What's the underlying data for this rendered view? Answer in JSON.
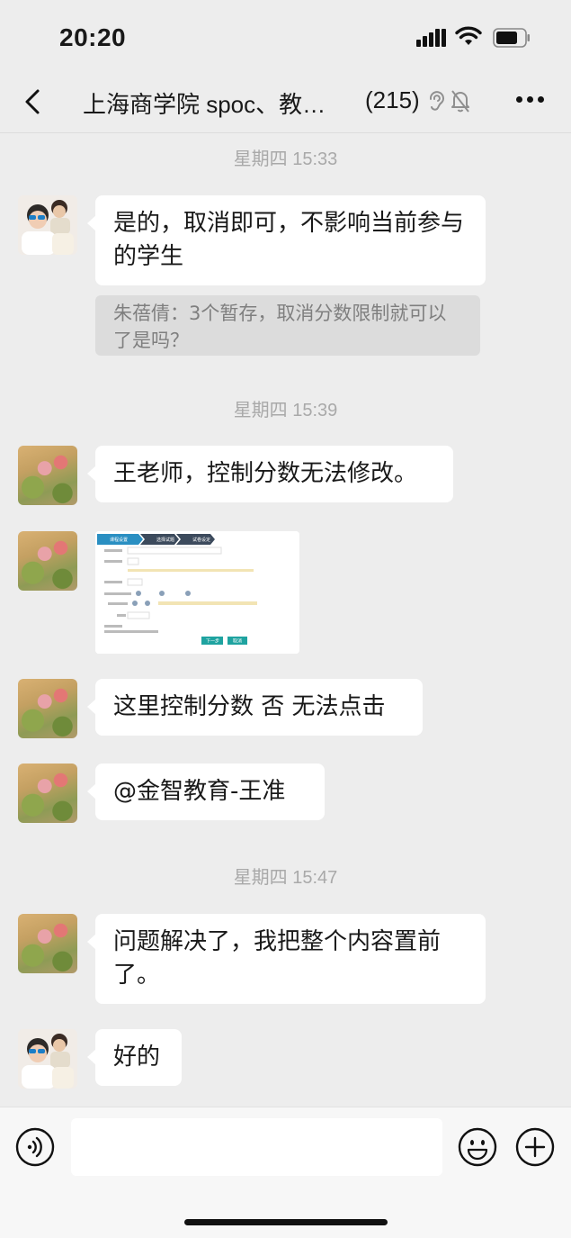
{
  "status_bar": {
    "time": "20:20"
  },
  "nav": {
    "title": "上海商学院 spoc、教…",
    "member_count": "(215)"
  },
  "messages": {
    "ts1": "星期四 15:33",
    "m1": "是的，取消即可，不影响当前参与的学生",
    "quote": "朱蓓倩：3个暂存，取消分数限制就可以了是吗？",
    "ts2": "星期四 15:39",
    "m2": "王老师，控制分数无法修改。",
    "screenshot": {
      "steps": [
        "课程设置",
        "选择试题",
        "试卷设定"
      ],
      "buttons": [
        "下一步",
        "取消"
      ]
    },
    "m3": "这里控制分数 否 无法点击",
    "m4": "@金智教育-王准",
    "ts3": "星期四 15:47",
    "m5": "问题解决了，我把整个内容置前了。",
    "m6": "好的"
  },
  "input_bar": {
    "placeholder": ""
  },
  "colors": {
    "background": "#ededed",
    "bubble": "#ffffff",
    "timestamp": "#a9a9a9",
    "quote_bg": "#dcdcdc",
    "teal_button": "#1fa3a0"
  }
}
